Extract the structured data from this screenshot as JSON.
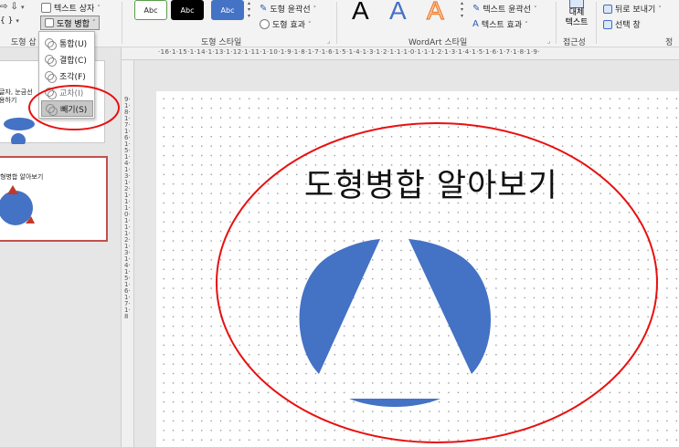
{
  "ribbon": {
    "text_box": "텍스트 상자",
    "shape_merge": "도형 병합",
    "shape_insert_group": "도형 삽",
    "shape_styles_group": "도형 스타일",
    "style_sample": "Abc",
    "shape_outline": "도형 윤곽선",
    "shape_effects": "도형 효과",
    "wordart_letter": "A",
    "wordart_group": "WordArt 스타일",
    "text_outline": "텍스트 윤곽선",
    "text_effects": "텍스트 효과",
    "alt_text_line1": "대체",
    "alt_text_line2": "텍스트",
    "accessibility_group": "접근성",
    "send_backward": "뒤로 보내기",
    "selection_pane": "선택 창",
    "arrange_group": "정"
  },
  "merge_menu": [
    {
      "label": "통합(U)",
      "state": "normal"
    },
    {
      "label": "결합(C)",
      "state": "normal"
    },
    {
      "label": "조각(F)",
      "state": "normal"
    },
    {
      "label": "교차(I)",
      "state": "dim"
    },
    {
      "label": "빼기(S)",
      "state": "selected"
    }
  ],
  "thumbnails": {
    "slide1_line1": "글자, 눈금선",
    "slide1_line2": "용하기",
    "slide2_title": "형병합 알아보기"
  },
  "ruler": {
    "top": "·16·1·15·1·14·1·13·1·12·1·11·1·10·1·9·1·8·1·7·1·6·1·5·1·4·1·3·1·2·1·1·1·0·1·1·1·2·1·3·1·4·1·5·1·6·1·7·1·8·1·9·",
    "left": "9·1·8·1·7·1·6·1·5·1·4·1·3·1·2·1·1·1·0·1·1·1·2·1·3·1·4·1·5·1·6·1·7·1·8"
  },
  "slide": {
    "title": "도형병합 알아보기"
  },
  "colors": {
    "shape_blue": "#4472c4",
    "annotation_red": "#e81010",
    "thumb_selected_border": "#c0504d"
  }
}
